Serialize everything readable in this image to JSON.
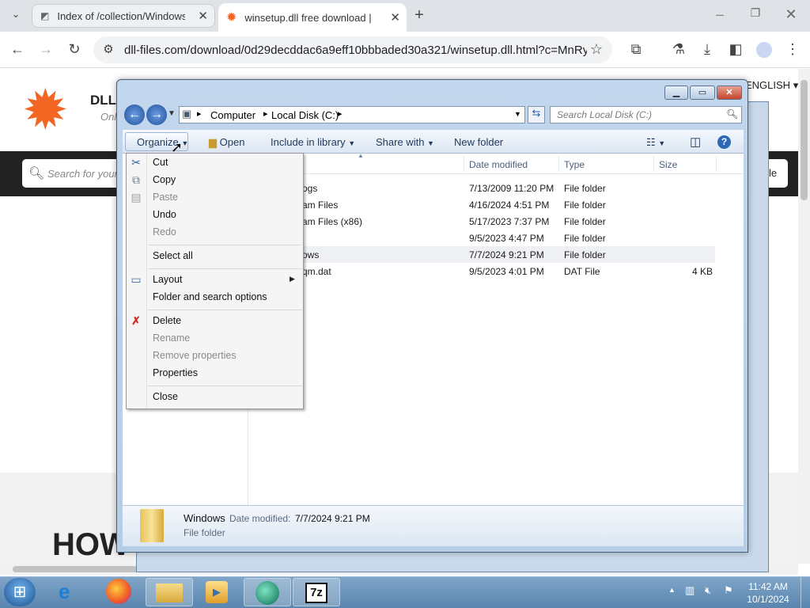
{
  "browser": {
    "tabs": [
      {
        "title": "Index of /collection/Windows"
      },
      {
        "title": "winsetup.dll free download | D"
      }
    ],
    "url": "dll-files.com/download/0d29decddac6a9eff10bbbaded30a321/winsetup.dll.html?c=MnRyVE..."
  },
  "website": {
    "logo_text": "DLL-",
    "logo_sub": "Onl",
    "language": "ENGLISH",
    "search_placeholder": "Search for your",
    "side_button": "le",
    "heading_partial": "HOW D"
  },
  "explorer": {
    "breadcrumb": [
      "Computer",
      "Local Disk (C:)"
    ],
    "search_placeholder": "Search Local Disk (C:)",
    "toolbar": {
      "organize": "Organize",
      "open": "Open",
      "include_in_library": "Include in library",
      "share_with": "Share with",
      "new_folder": "New folder"
    },
    "columns": {
      "date_modified": "Date modified",
      "type": "Type",
      "size": "Size"
    },
    "files": [
      {
        "name": "ogs",
        "date": "7/13/2009 11:20 PM",
        "type": "File folder",
        "size": ""
      },
      {
        "name": "am Files",
        "date": "4/16/2024 4:51 PM",
        "type": "File folder",
        "size": ""
      },
      {
        "name": "am Files (x86)",
        "date": "5/17/2023 7:37 PM",
        "type": "File folder",
        "size": ""
      },
      {
        "name": "",
        "date": "9/5/2023 4:47 PM",
        "type": "File folder",
        "size": ""
      },
      {
        "name": "ows",
        "date": "7/7/2024 9:21 PM",
        "type": "File folder",
        "size": ""
      },
      {
        "name": "qm.dat",
        "date": "9/5/2023 4:01 PM",
        "type": "DAT File",
        "size": "4 KB"
      }
    ],
    "details": {
      "name": "Windows",
      "date_label": "Date modified:",
      "date_value": "7/7/2024 9:21 PM",
      "type": "File folder"
    }
  },
  "organize_menu": {
    "cut": "Cut",
    "copy": "Copy",
    "paste": "Paste",
    "undo": "Undo",
    "redo": "Redo",
    "select_all": "Select all",
    "layout": "Layout",
    "folder_options": "Folder and search options",
    "delete": "Delete",
    "rename": "Rename",
    "remove_properties": "Remove properties",
    "properties": "Properties",
    "close": "Close"
  },
  "taskbar": {
    "time": "11:42 AM",
    "date": "10/1/2024"
  },
  "colors": {
    "brand_orange": "#f26522",
    "win_title": "#b9cfe8",
    "taskbar": "#5f8ab2"
  }
}
